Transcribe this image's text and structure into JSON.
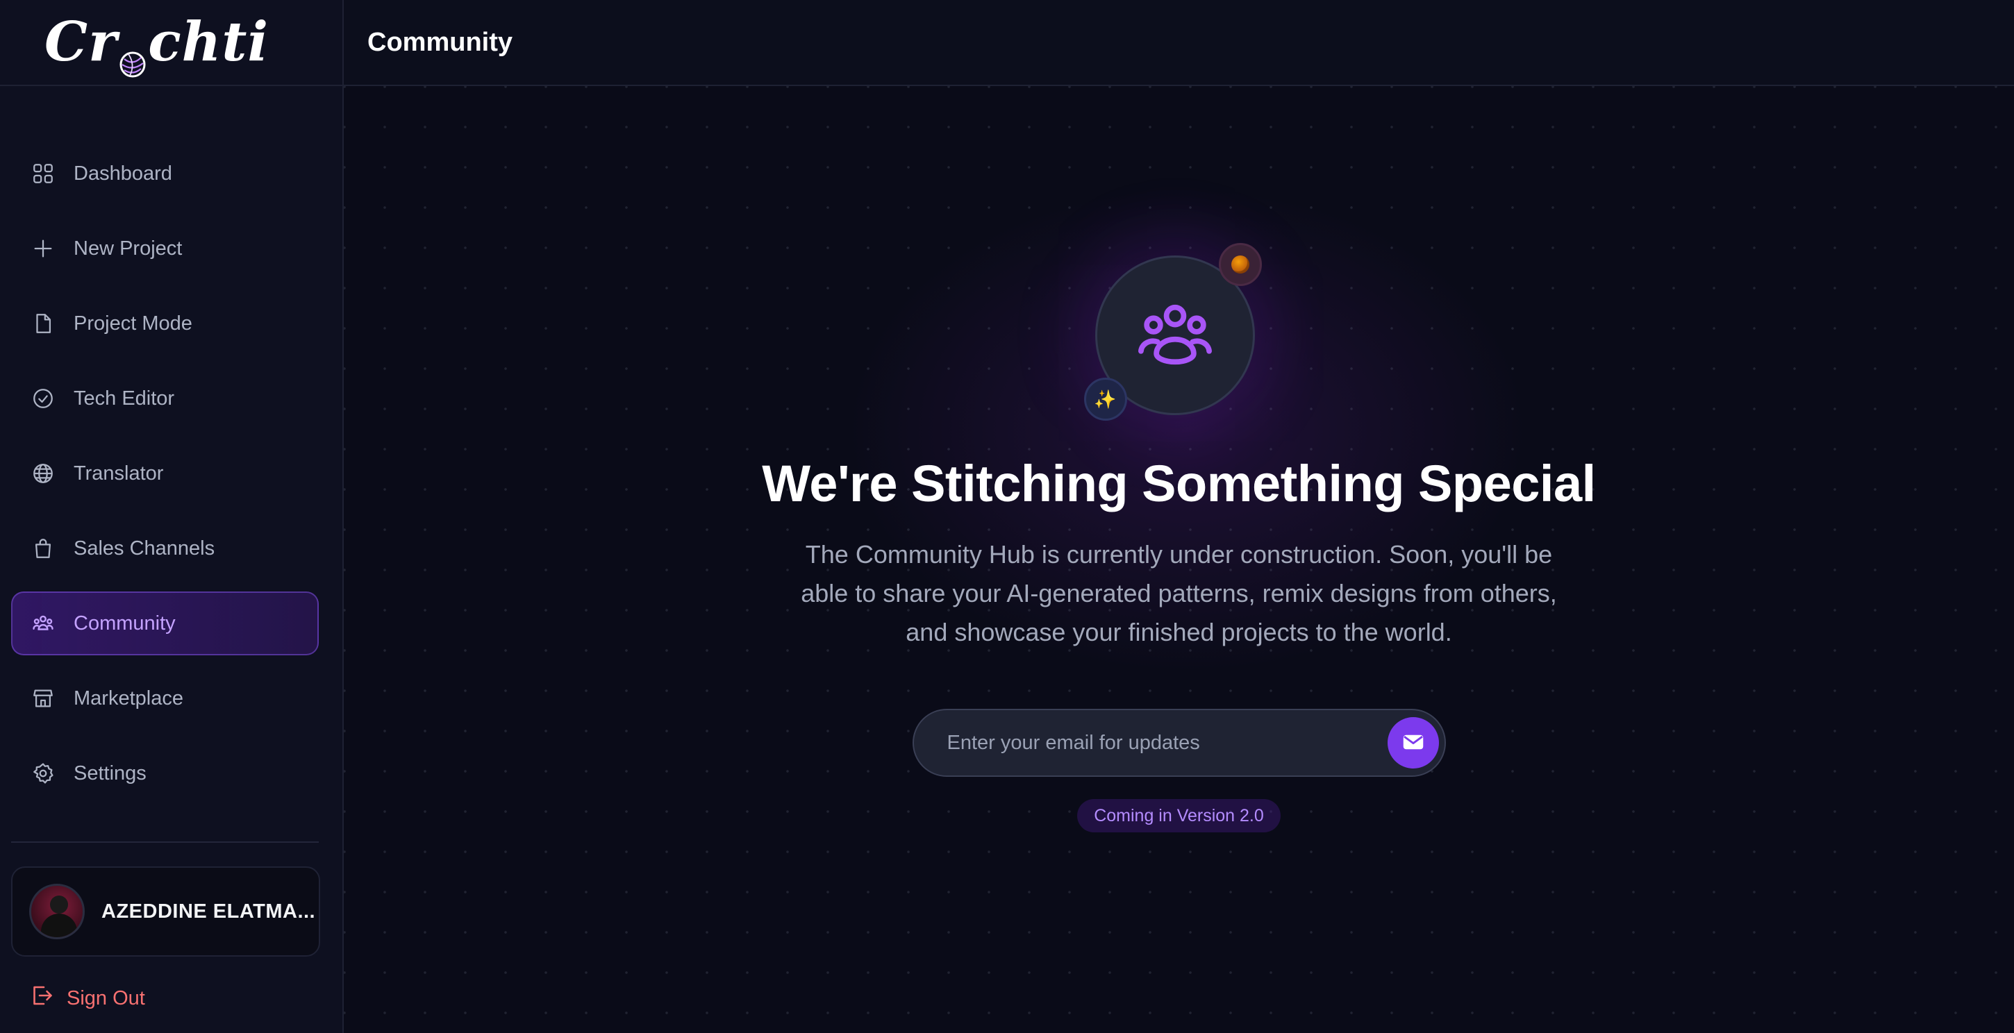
{
  "brand": {
    "name_pre": "Cr",
    "name_post": "chti"
  },
  "header": {
    "title": "Community"
  },
  "sidebar": {
    "items": [
      {
        "label": "Dashboard",
        "icon": "grid-icon"
      },
      {
        "label": "New Project",
        "icon": "plus-icon"
      },
      {
        "label": "Project Mode",
        "icon": "file-icon"
      },
      {
        "label": "Tech Editor",
        "icon": "check-circle-icon"
      },
      {
        "label": "Translator",
        "icon": "globe-icon"
      },
      {
        "label": "Sales Channels",
        "icon": "shopping-bag-icon"
      },
      {
        "label": "Community",
        "icon": "users-icon",
        "active": true
      },
      {
        "label": "Marketplace",
        "icon": "store-icon"
      },
      {
        "label": "Settings",
        "icon": "gear-icon"
      }
    ],
    "user": {
      "name": "AZEDDINE ELATMA..."
    },
    "signout_label": "Sign Out"
  },
  "hero": {
    "title": "We're Stitching Something Special",
    "text": "The Community Hub is currently under construction. Soon, you'll be able to share your AI-generated patterns, remix designs from others, and showcase your finished projects to the world.",
    "email_placeholder": "Enter your email for updates",
    "email_value": "",
    "version_badge": "Coming in Version 2.0",
    "spark_badge": "✨"
  },
  "colors": {
    "accent": "#7c3aed",
    "accent_text": "#b48cff",
    "background": "#0a0b18",
    "sidebar": "#0e1020",
    "danger": "#f87171"
  }
}
